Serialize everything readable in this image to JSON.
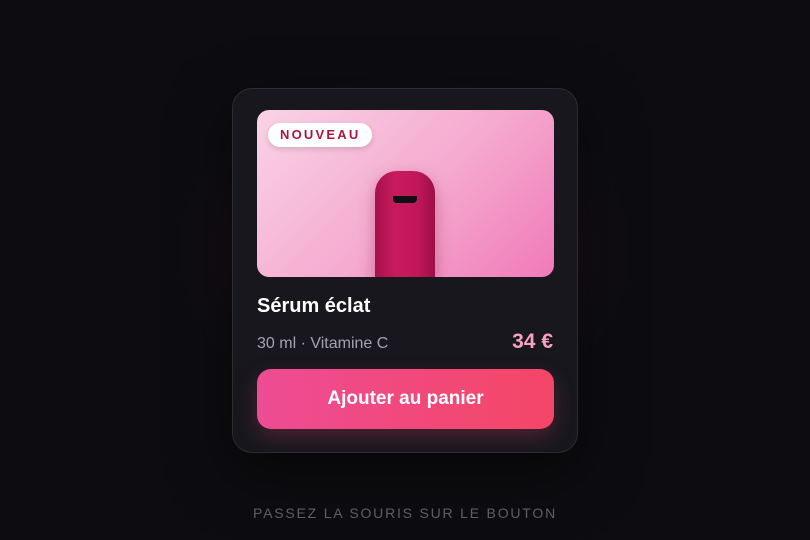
{
  "product": {
    "badge": "NOUVEAU",
    "name": "Sérum éclat",
    "details": "30 ml · Vitamine C",
    "price": "34 €",
    "cta_label": "Ajouter au panier"
  },
  "hint": "PASSEZ LA SOURIS SUR LE BOUTON",
  "colors": {
    "background": "#0d0d11",
    "card": "#17171d",
    "accent": "#ee4c94",
    "price": "#f7a1bf",
    "badge_text": "#a8173f",
    "bottle": "#c81b5d"
  }
}
